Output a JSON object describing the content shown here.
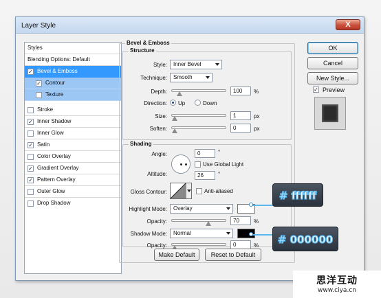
{
  "window": {
    "title": "Layer Style",
    "close_symbol": "X"
  },
  "styles_panel": {
    "header": "Styles",
    "blending_options": "Blending Options: Default",
    "items": [
      {
        "label": "Bevel & Emboss",
        "checked": true,
        "state": "selected"
      },
      {
        "label": "Contour",
        "checked": true,
        "state": "sub"
      },
      {
        "label": "Texture",
        "checked": false,
        "state": "sub"
      },
      {
        "label": "Stroke",
        "checked": false
      },
      {
        "label": "Inner Shadow",
        "checked": true
      },
      {
        "label": "Inner Glow",
        "checked": false
      },
      {
        "label": "Satin",
        "checked": true
      },
      {
        "label": "Color Overlay",
        "checked": false
      },
      {
        "label": "Gradient Overlay",
        "checked": true
      },
      {
        "label": "Pattern Overlay",
        "checked": true
      },
      {
        "label": "Outer Glow",
        "checked": false
      },
      {
        "label": "Drop Shadow",
        "checked": false
      }
    ]
  },
  "bevel": {
    "title": "Bevel & Emboss",
    "structure": {
      "legend": "Structure",
      "style_label": "Style:",
      "style_value": "Inner Bevel",
      "technique_label": "Technique:",
      "technique_value": "Smooth",
      "depth_label": "Depth:",
      "depth_value": "100",
      "depth_unit": "%",
      "depth_level": 0.1,
      "direction_label": "Direction:",
      "up_label": "Up",
      "down_label": "Down",
      "direction_value": "Up",
      "size_label": "Size:",
      "size_value": "1",
      "size_unit": "px",
      "size_level": 0.0,
      "soften_label": "Soften:",
      "soften_value": "0",
      "soften_unit": "px",
      "soften_level": 0.0
    },
    "shading": {
      "legend": "Shading",
      "angle_label": "Angle:",
      "angle_value": "0",
      "angle_unit": "°",
      "global_light_label": "Use Global Light",
      "global_light_checked": false,
      "altitude_label": "Altitude:",
      "altitude_value": "26",
      "altitude_unit": "°",
      "gloss_contour_label": "Gloss Contour:",
      "anti_aliased_label": "Anti-aliased",
      "anti_aliased_checked": false,
      "highlight_mode_label": "Highlight Mode:",
      "highlight_mode_value": "Overlay",
      "highlight_color": "#ffffff",
      "highlight_opacity_label": "Opacity:",
      "highlight_opacity_value": "70",
      "highlight_opacity_unit": "%",
      "highlight_opacity_level": 0.7,
      "shadow_mode_label": "Shadow Mode:",
      "shadow_mode_value": "Normal",
      "shadow_color": "#000000",
      "shadow_opacity_label": "Opacity:",
      "shadow_opacity_value": "0",
      "shadow_opacity_unit": "%",
      "shadow_opacity_level": 0.0
    },
    "make_default_label": "Make Default",
    "reset_default_label": "Reset to Default"
  },
  "buttons": {
    "ok": "OK",
    "cancel": "Cancel",
    "new_style": "New Style...",
    "preview_label": "Preview",
    "preview_checked": true
  },
  "callouts": {
    "highlight_hex": "# ffffff",
    "shadow_hex": "# 000000",
    "accent": "#5ab8f0"
  },
  "watermark": {
    "name": "思洋互动",
    "url": "www.ciya.cn"
  }
}
